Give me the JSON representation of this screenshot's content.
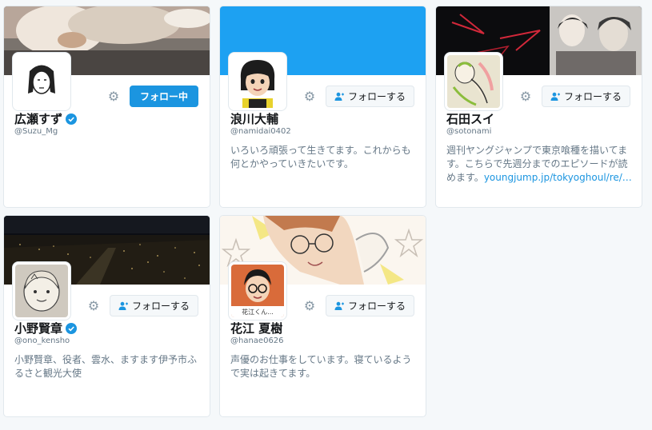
{
  "cards": [
    {
      "name": "広瀬すず",
      "handle": "@Suzu_Mg",
      "verified": true,
      "bio": "",
      "button_label": "フォロー中",
      "following": true
    },
    {
      "name": "浪川大輔",
      "handle": "@namidai0402",
      "verified": false,
      "bio": "いろいろ頑張って生きてます。これからも何とかやっていきたいです。",
      "button_label": "フォローする",
      "following": false
    },
    {
      "name": "石田スイ",
      "handle": "@sotonami",
      "verified": false,
      "bio": "週刊ヤングジャンプで東京喰種を描いてます。こちらで先週分までのエピソードが読めます。",
      "bio_link": "youngjump.jp/tokyoghoul/re/…",
      "button_label": "フォローする",
      "following": false
    },
    {
      "name": "小野賢章",
      "handle": "@ono_kensho",
      "verified": true,
      "bio": "小野賢章、役者、雲水、ますます伊予市ふるさと観光大使",
      "button_label": "フォローする",
      "following": false
    },
    {
      "name": "花江 夏樹",
      "handle": "@hanae0626",
      "verified": false,
      "bio": "声優のお仕事をしています。寝ているようで実は起きてます。",
      "avatar_caption": "花江くん...",
      "button_label": "フォローする",
      "following": false
    }
  ],
  "colors": {
    "accent": "#1b95e0",
    "page_bg": "#f5f8fa",
    "secondary_text": "#657786"
  },
  "icons": {
    "settings": "gear-icon",
    "follow": "person-add-icon",
    "verified": "verified-badge-icon"
  }
}
